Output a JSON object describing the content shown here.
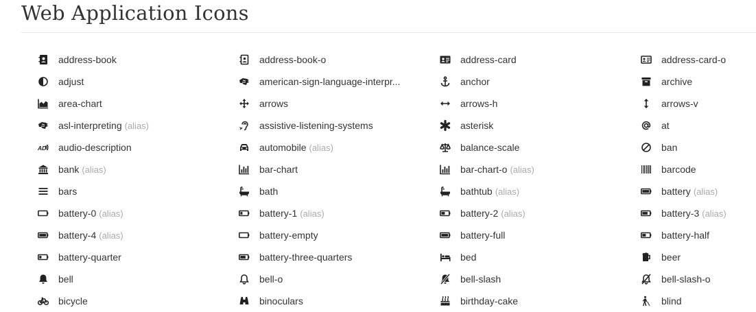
{
  "page": {
    "title": "Web Application Icons"
  },
  "alias_label": "(alias)",
  "icons": [
    {
      "name": "address-book",
      "icon": "address-book-icon",
      "alias": false
    },
    {
      "name": "address-book-o",
      "icon": "address-book-o-icon",
      "alias": false
    },
    {
      "name": "address-card",
      "icon": "address-card-icon",
      "alias": false
    },
    {
      "name": "address-card-o",
      "icon": "address-card-o-icon",
      "alias": false
    },
    {
      "name": "adjust",
      "icon": "adjust-icon",
      "alias": false
    },
    {
      "name": "american-sign-language-interpr...",
      "icon": "asl-icon",
      "alias": false
    },
    {
      "name": "anchor",
      "icon": "anchor-icon",
      "alias": false
    },
    {
      "name": "archive",
      "icon": "archive-icon",
      "alias": false
    },
    {
      "name": "area-chart",
      "icon": "area-chart-icon",
      "alias": false
    },
    {
      "name": "arrows",
      "icon": "arrows-icon",
      "alias": false
    },
    {
      "name": "arrows-h",
      "icon": "arrows-h-icon",
      "alias": false
    },
    {
      "name": "arrows-v",
      "icon": "arrows-v-icon",
      "alias": false
    },
    {
      "name": "asl-interpreting",
      "icon": "asl-icon",
      "alias": true
    },
    {
      "name": "assistive-listening-systems",
      "icon": "ear-icon",
      "alias": false
    },
    {
      "name": "asterisk",
      "icon": "asterisk-icon",
      "alias": false
    },
    {
      "name": "at",
      "icon": "at-icon",
      "alias": false
    },
    {
      "name": "audio-description",
      "icon": "audio-description-icon",
      "alias": false
    },
    {
      "name": "automobile",
      "icon": "car-icon",
      "alias": true
    },
    {
      "name": "balance-scale",
      "icon": "balance-scale-icon",
      "alias": false
    },
    {
      "name": "ban",
      "icon": "ban-icon",
      "alias": false
    },
    {
      "name": "bank",
      "icon": "bank-icon",
      "alias": true
    },
    {
      "name": "bar-chart",
      "icon": "bar-chart-icon",
      "alias": false
    },
    {
      "name": "bar-chart-o",
      "icon": "bar-chart-icon",
      "alias": true
    },
    {
      "name": "barcode",
      "icon": "barcode-icon",
      "alias": false
    },
    {
      "name": "bars",
      "icon": "bars-icon",
      "alias": false
    },
    {
      "name": "bath",
      "icon": "bath-icon",
      "alias": false
    },
    {
      "name": "bathtub",
      "icon": "bath-icon",
      "alias": true
    },
    {
      "name": "battery",
      "icon": "battery-full-icon",
      "alias": true
    },
    {
      "name": "battery-0",
      "icon": "battery-empty-icon",
      "alias": true
    },
    {
      "name": "battery-1",
      "icon": "battery-quarter-icon",
      "alias": true
    },
    {
      "name": "battery-2",
      "icon": "battery-half-icon",
      "alias": true
    },
    {
      "name": "battery-3",
      "icon": "battery-three-quarters-icon",
      "alias": true
    },
    {
      "name": "battery-4",
      "icon": "battery-full-icon",
      "alias": true
    },
    {
      "name": "battery-empty",
      "icon": "battery-empty-icon",
      "alias": false
    },
    {
      "name": "battery-full",
      "icon": "battery-full-icon",
      "alias": false
    },
    {
      "name": "battery-half",
      "icon": "battery-half-icon",
      "alias": false
    },
    {
      "name": "battery-quarter",
      "icon": "battery-quarter-icon",
      "alias": false
    },
    {
      "name": "battery-three-quarters",
      "icon": "battery-three-quarters-icon",
      "alias": false
    },
    {
      "name": "bed",
      "icon": "bed-icon",
      "alias": false
    },
    {
      "name": "beer",
      "icon": "beer-icon",
      "alias": false
    },
    {
      "name": "bell",
      "icon": "bell-icon",
      "alias": false
    },
    {
      "name": "bell-o",
      "icon": "bell-o-icon",
      "alias": false
    },
    {
      "name": "bell-slash",
      "icon": "bell-slash-icon",
      "alias": false
    },
    {
      "name": "bell-slash-o",
      "icon": "bell-slash-o-icon",
      "alias": false
    },
    {
      "name": "bicycle",
      "icon": "bicycle-icon",
      "alias": false
    },
    {
      "name": "binoculars",
      "icon": "binoculars-icon",
      "alias": false
    },
    {
      "name": "birthday-cake",
      "icon": "birthday-cake-icon",
      "alias": false
    },
    {
      "name": "blind",
      "icon": "blind-icon",
      "alias": false
    }
  ]
}
